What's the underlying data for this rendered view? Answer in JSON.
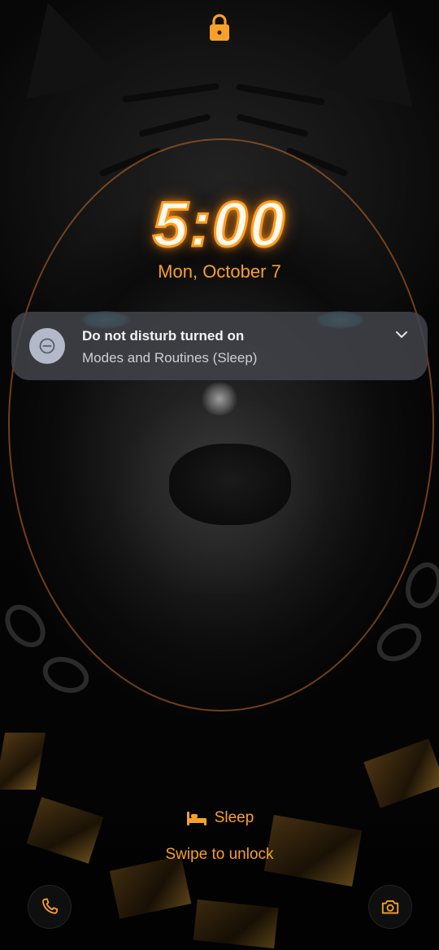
{
  "lockscreen": {
    "time": "5:00",
    "date": "Mon, October 7",
    "lock_icon": "lock-icon",
    "accent_color": "#f8a02a"
  },
  "notification": {
    "icon": "do-not-disturb-icon",
    "title": "Do not disturb turned on",
    "body": "Modes and Routines (Sleep)",
    "expand_icon": "chevron-down-icon"
  },
  "mode": {
    "icon": "bed-icon",
    "label": "Sleep"
  },
  "hint": {
    "text": "Swipe to unlock"
  },
  "shortcuts": {
    "left_icon": "phone-icon",
    "right_icon": "camera-icon"
  }
}
